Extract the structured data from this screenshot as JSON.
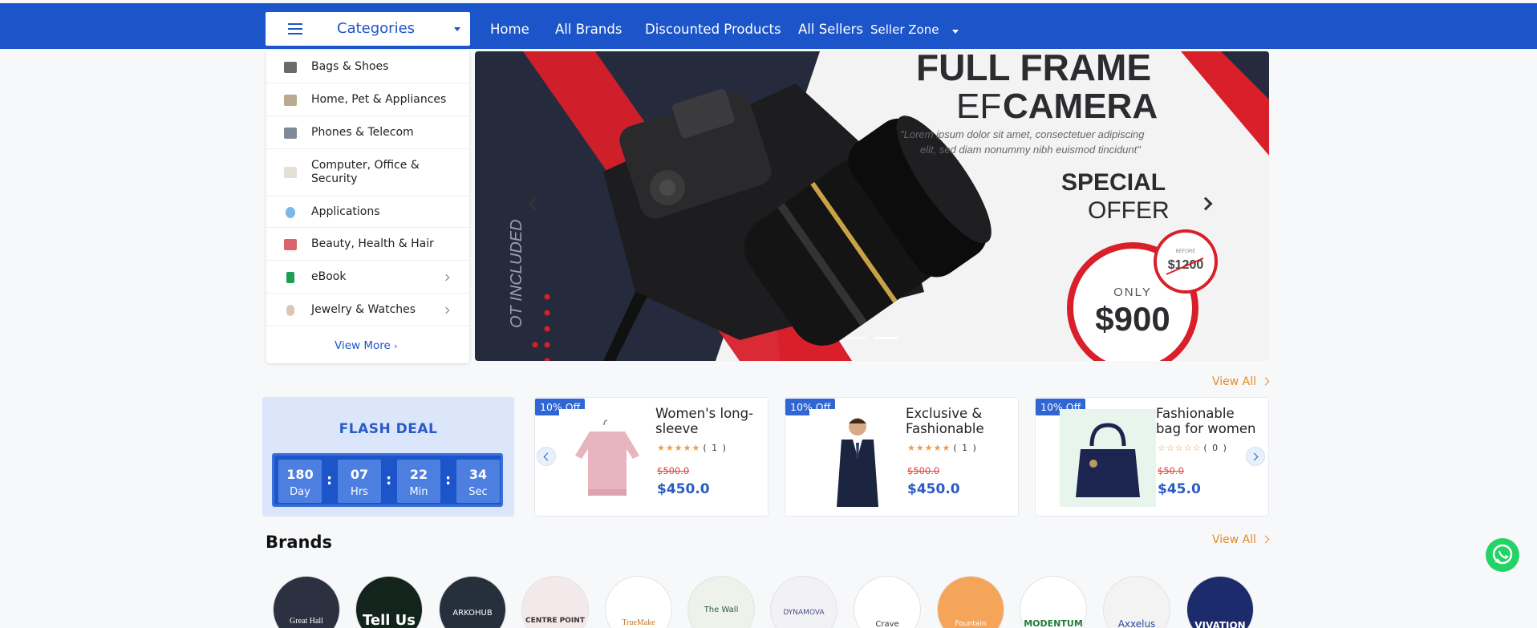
{
  "nav": {
    "categories_label": "Categories",
    "links": [
      "Home",
      "All Brands",
      "Discounted Products",
      "All Sellers"
    ],
    "seller_zone": "Seller Zone"
  },
  "category_menu": {
    "items": [
      {
        "label": "Bags & Shoes",
        "has_sub": false
      },
      {
        "label": "Home, Pet & Appliances",
        "has_sub": false
      },
      {
        "label": "Phones & Telecom",
        "has_sub": false
      },
      {
        "label": "Computer, Office & Security",
        "has_sub": false
      },
      {
        "label": "Applications",
        "has_sub": false
      },
      {
        "label": "Beauty, Health & Hair",
        "has_sub": false
      },
      {
        "label": "eBook",
        "has_sub": true
      },
      {
        "label": "Jewelry & Watches",
        "has_sub": true
      }
    ],
    "view_more": "View More"
  },
  "hero": {
    "headline_1": "FULL FRAME",
    "headline_2a": "EF",
    "headline_2b": "CAMERA",
    "quote_1": "\"Lorem ipsum dolor sit amet, consectetuer adipiscing",
    "quote_2": "elit, sed diam nonummy nibh euismod tincidunt\"",
    "special": "SPECIAL",
    "offer": "OFFER",
    "before_label": "BEFORE",
    "before_price": "$1200",
    "only": "ONLY",
    "price": "$900",
    "side_text": "OT INCLUDED"
  },
  "flash_deal": {
    "view_all": "View All",
    "title": "FLASH DEAL",
    "timer": [
      {
        "value": "180",
        "unit": "Day"
      },
      {
        "value": "07",
        "unit": "Hrs"
      },
      {
        "value": "22",
        "unit": "Min"
      },
      {
        "value": "34",
        "unit": "Sec"
      }
    ],
    "products": [
      {
        "badge": "10% Off",
        "name": "Women's long-sleeve",
        "rating": 5,
        "reviews": "( 1 )",
        "old_price": "$500.0",
        "price": "$450.0"
      },
      {
        "badge": "10% Off",
        "name": "Exclusive & Fashionable",
        "rating": 5,
        "reviews": "( 1 )",
        "old_price": "$500.0",
        "price": "$450.0"
      },
      {
        "badge": "10% Off",
        "name": "Fashionable bag for women",
        "rating": 0,
        "reviews": "( 0 )",
        "old_price": "$50.0",
        "price": "$45.0"
      }
    ]
  },
  "brands": {
    "title": "Brands",
    "view_all": "View All",
    "items": [
      "Great Hall",
      "Tell Us",
      "ARKOHUB",
      "CENTRE POINT",
      "TrueMake",
      "The Wall",
      "DYNAMOVA",
      "Crave",
      "Fountain",
      "MODENTUM",
      "Axxelus",
      "VIVATION"
    ]
  },
  "colors": {
    "primary": "#1c55c9",
    "accent": "#e88a1b",
    "sale": "#e0453a",
    "whatsapp": "#24d366"
  }
}
